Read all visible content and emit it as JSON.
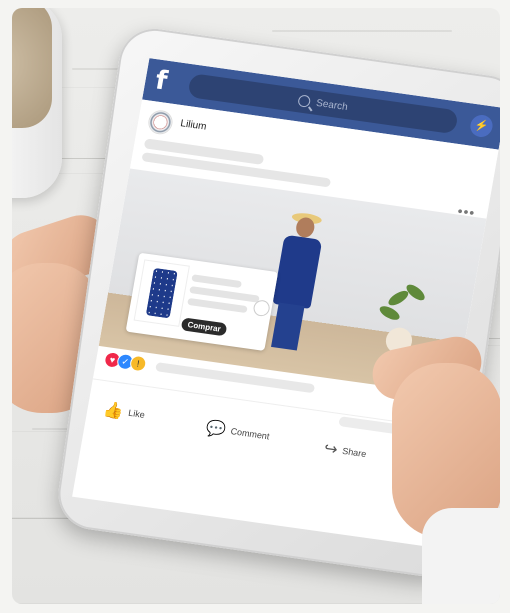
{
  "app": {
    "brand_letter": "f",
    "search_placeholder": "Search",
    "brand_color": "#3b5998"
  },
  "post": {
    "author": "Lilium",
    "shop_button": "Comprar"
  },
  "actions": {
    "like": "Like",
    "comment": "Comment",
    "share": "Share"
  },
  "icons": {
    "search": "search-icon",
    "messenger": "messenger-icon",
    "like": "thumbs-up-icon",
    "comment": "comment-icon",
    "share": "share-icon",
    "more": "more-dots-icon"
  }
}
